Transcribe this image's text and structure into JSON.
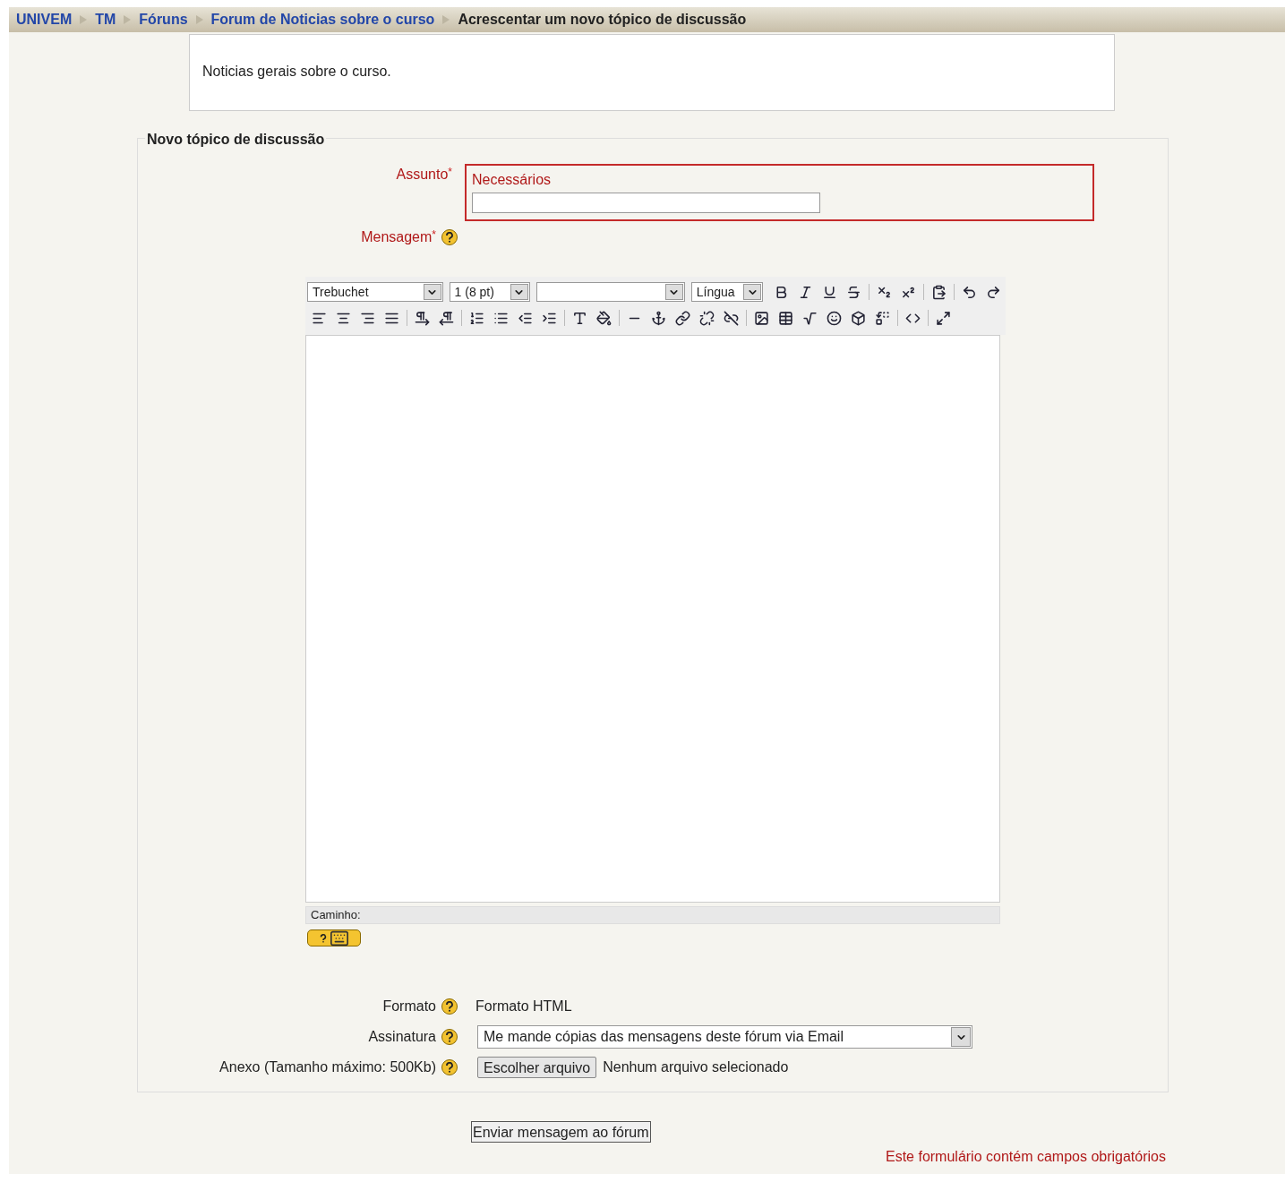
{
  "breadcrumb": [
    {
      "label": "UNIVEM",
      "link": true
    },
    {
      "label": "TM",
      "link": true
    },
    {
      "label": "Fóruns",
      "link": true
    },
    {
      "label": "Forum de Noticias sobre o curso",
      "link": true
    },
    {
      "label": "Acrescentar um novo tópico de discussão",
      "link": false
    }
  ],
  "forum_intro": "Noticias gerais sobre o curso.",
  "form": {
    "legend": "Novo tópico de discussão",
    "subject": {
      "label": "Assunto",
      "required_mark": "*",
      "error": "Necessários"
    },
    "message": {
      "label": "Mensagem",
      "required_mark": "*",
      "editor": {
        "dropdowns": [
          {
            "kind": "font",
            "value": "Trebuchet"
          },
          {
            "kind": "size",
            "value": "1 (8 pt)"
          },
          {
            "kind": "format"
          },
          {
            "kind": "language",
            "value": "Língua"
          }
        ],
        "path_label": "Caminho:"
      }
    },
    "format": {
      "label": "Formato",
      "value": "Formato HTML"
    },
    "signature": {
      "label": "Assinatura",
      "value": "Me mande cópias das mensagens deste fórum via Email"
    },
    "attachment": {
      "label": "Anexo (Tamanho máximo: 500Kb)",
      "button": "Escolher arquivo",
      "status": "Nenhum arquivo selecionado"
    }
  },
  "submit": "Enviar mensagem ao fórum",
  "required_note": "Este formulário contém campos obrigatórios"
}
